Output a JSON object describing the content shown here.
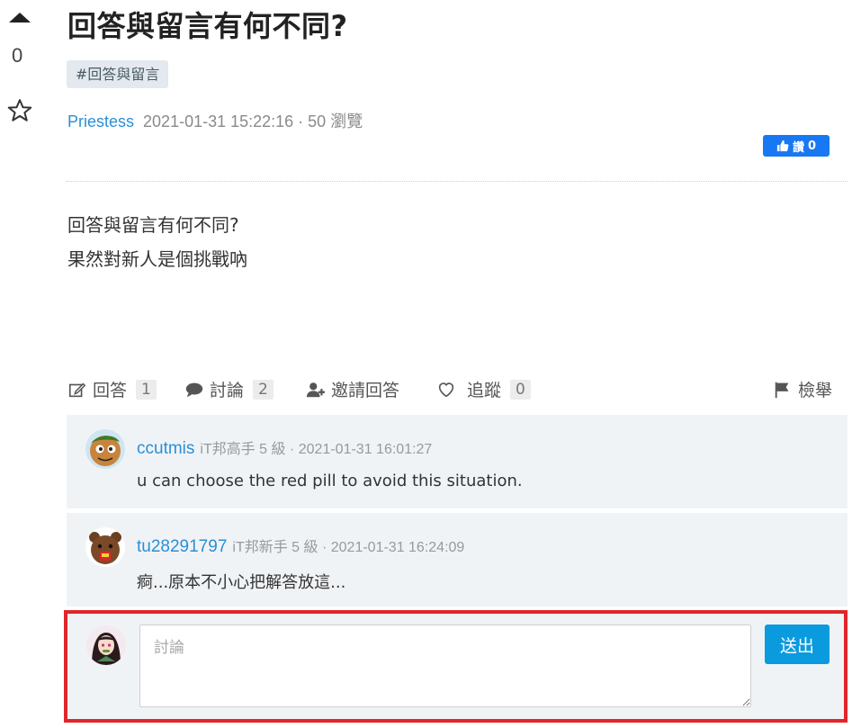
{
  "vote": {
    "count": "0"
  },
  "question": {
    "title": "回答與留言有何不同?",
    "tag": "#回答與留言",
    "author": "Priestess",
    "date": "2021-01-31 15:22:16 · 50 瀏覽",
    "body_lines": [
      "回答與留言有何不同?",
      "果然對新人是個挑戰吶"
    ]
  },
  "fb_like": {
    "label": "讚",
    "count": "0"
  },
  "actions": {
    "answer_label": "回答",
    "answer_count": "1",
    "discuss_label": "討論",
    "discuss_count": "2",
    "invite_label": "邀請回答",
    "follow_label": "追蹤",
    "follow_count": "0",
    "report_label": "檢舉"
  },
  "comments": [
    {
      "name": "ccutmis",
      "rank": "iT邦高手 5 級",
      "date": "· 2021-01-31 16:01:27",
      "text": "u can choose the red pill to avoid this situation."
    },
    {
      "name": "tu28291797",
      "rank": "iT邦新手 5 級",
      "date": "· 2021-01-31 16:24:09",
      "text": "痾...原本不小心把解答放這..."
    }
  ],
  "compose": {
    "placeholder": "討論",
    "submit_label": "送出"
  },
  "colors": {
    "link": "#2a8fd6",
    "accent": "#0a9bdf",
    "highlight": "#e0262a",
    "panel": "#f0f3f6"
  }
}
